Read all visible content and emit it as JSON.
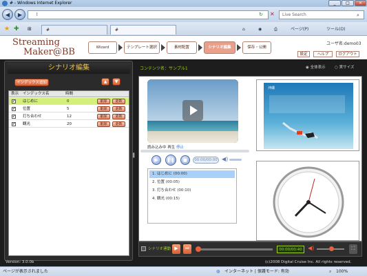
{
  "browser": {
    "title": "# - Windows Internet Explorer",
    "address": "l              ",
    "search_placeholder": "Live Search",
    "tabs": [
      "#",
      "#"
    ],
    "commands": [
      "ページ(P)",
      "ツール(O)"
    ],
    "status_left": "ページが表示されました",
    "status_zone": "インターネット | 保護モード: 有効",
    "zoom": "100%"
  },
  "app": {
    "logo_line1": "Streaming",
    "logo_line2": "Maker@BB",
    "steps": [
      "Wizard",
      "テンプレート選択",
      "素材配置",
      "シナリオ編集",
      "保存・公開"
    ],
    "active_step": 3,
    "user": "ユーザ名:demo03",
    "top_buttons": [
      "設定",
      "ヘルプ",
      "ログアウト"
    ],
    "footer_version": "Version: 3.0.0b",
    "footer_copyright": "(c)2008 Digital Cruise Inc. All rights reserved."
  },
  "scenario": {
    "title": "シナリオ編集",
    "add_index_label": "インデックス追加",
    "columns": [
      "表示",
      "インデックス名",
      "時間"
    ],
    "rows": [
      {
        "name": "はじめに",
        "time": "0"
      },
      {
        "name": "位置",
        "time": "5"
      },
      {
        "name": "打ち合わせ",
        "time": "12"
      },
      {
        "name": "観光",
        "time": "20"
      }
    ],
    "delete_label": "削除",
    "update_label": "更新"
  },
  "preview": {
    "content_name": "コンテンツ名：サンプル1",
    "radio_full": "全体表示",
    "radio_actual": "実サイズ",
    "status_loading": "読み込み中",
    "status_play": "再生",
    "status_stop": "停止",
    "time_display": "00:00/00:00",
    "chapters": [
      "1. はじめに (00:00)",
      "2. 位置 (00:05)",
      "3. 打ち合わせ (00:10)",
      "4. 観光 (00:15)"
    ],
    "slide_title": "沖縄"
  },
  "timeline": {
    "link_label": "シナリオ連動",
    "time_display": "00:00/00:40"
  }
}
